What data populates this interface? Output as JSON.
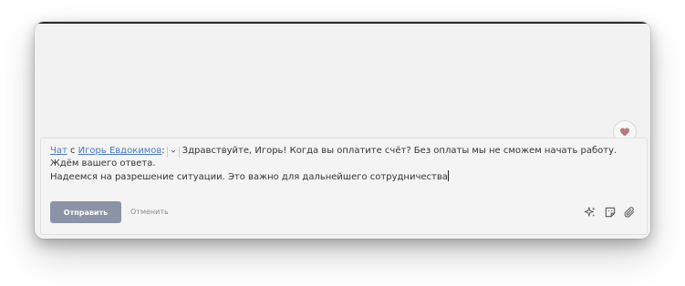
{
  "message": {
    "chat_link": "Чат",
    "with_word": " с ",
    "contact_link": "Игорь Евдокимов",
    "colon": ":",
    "line1": "Здравствуйте, Игорь! Когда вы оплатите счёт? Без оплаты мы не сможем начать работу. Ждём вашего ответа.",
    "line2": "Надеемся на разрешение ситуации. Это важно для дальнейшего сотрудничества"
  },
  "actions": {
    "send_label": "Отправить",
    "cancel_label": "Отменить"
  },
  "icons": {
    "like": "heart-icon",
    "recipient_menu": "chevron-down-icon",
    "ai": "sparkles-icon",
    "sticker": "sticker-icon",
    "attach": "paperclip-icon"
  },
  "colors": {
    "link": "#4a78c2",
    "send_button": "#8b93a6",
    "heart": "#b87a80"
  }
}
